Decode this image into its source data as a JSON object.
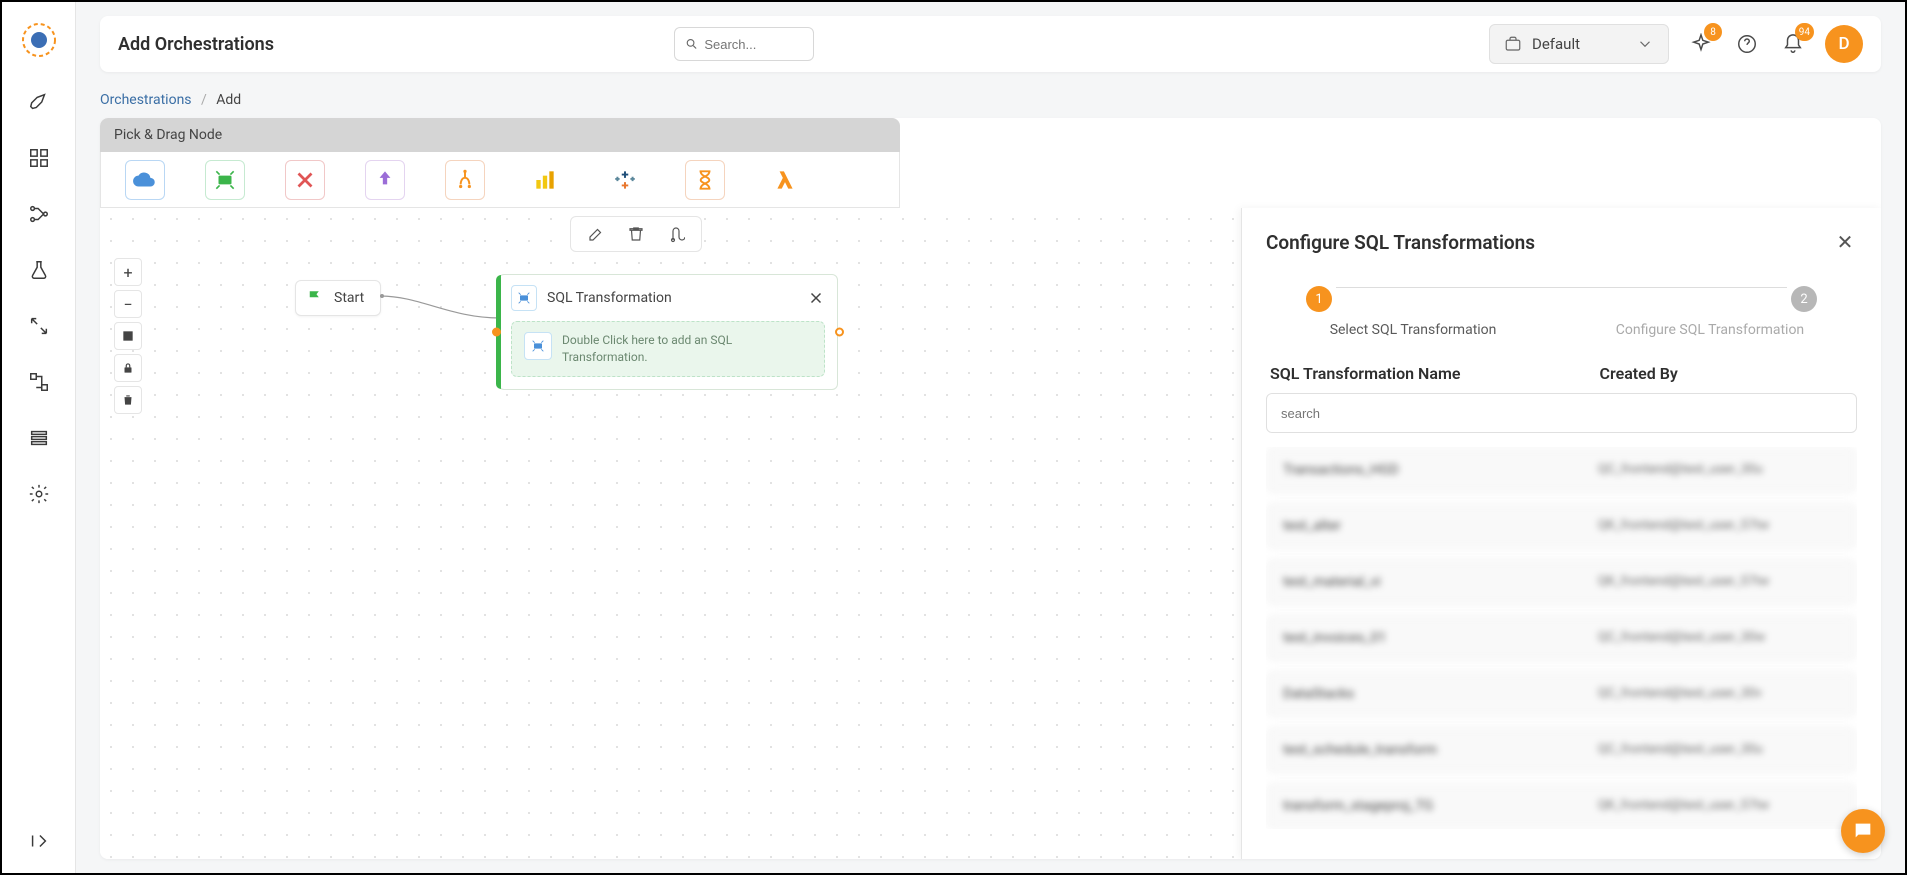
{
  "header": {
    "title": "Add Orchestrations",
    "search_placeholder": "Search...",
    "workspace": "Default",
    "sparkle_badge": "8",
    "bell_badge": "94",
    "avatar_letter": "D"
  },
  "breadcrumb": {
    "root": "Orchestrations",
    "current": "Add"
  },
  "palette": {
    "header": "Pick & Drag Node"
  },
  "canvas": {
    "start_label": "Start",
    "node_title": "SQL Transformation",
    "node_hint": "Double Click here to add an SQL Transformation."
  },
  "panel": {
    "title": "Configure SQL Transformations",
    "step1_num": "1",
    "step2_num": "2",
    "step1_label": "Select SQL Transformation",
    "step2_label": "Configure SQL Transformation",
    "col1": "SQL Transformation Name",
    "col2": "Created By",
    "search_placeholder": "search",
    "items": [
      {
        "name": "Transactions_HGD",
        "by": "QC_frontend@test_user_30u"
      },
      {
        "name": "test_alter",
        "by": "QK_frontend@test_user_57tw"
      },
      {
        "name": "test_material_vi",
        "by": "QK_frontend@test_user_57tw"
      },
      {
        "name": "test_invoices_01",
        "by": "QC_frontend@test_user_30w"
      },
      {
        "name": "DataStacks",
        "by": "QC_frontend@test_user_30v"
      },
      {
        "name": "test_schedule_transform",
        "by": "QC_frontend@test_user_30u"
      },
      {
        "name": "transform_stageproj_TG",
        "by": "QK_frontend@test_user_57tw"
      }
    ]
  }
}
